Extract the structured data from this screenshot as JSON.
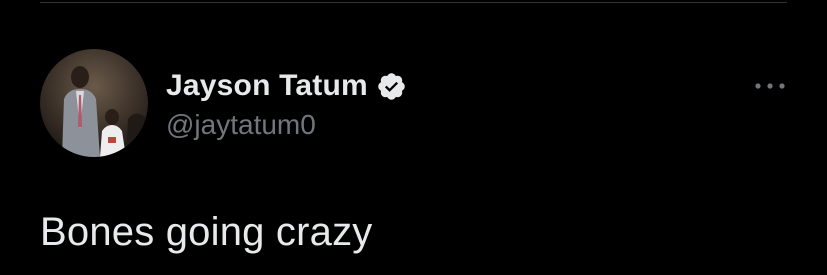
{
  "tweet": {
    "author": {
      "display_name": "Jayson Tatum",
      "handle": "@jaytatum0",
      "verified": true,
      "verified_icon": "verified-badge-icon",
      "avatar": "avatar-photo"
    },
    "more_icon": "more-horizontal-icon",
    "text": "Bones going crazy"
  },
  "colors": {
    "background": "#000000",
    "primary_text": "#e7e9ea",
    "secondary_text": "#71767b",
    "divider": "#2f3336"
  }
}
